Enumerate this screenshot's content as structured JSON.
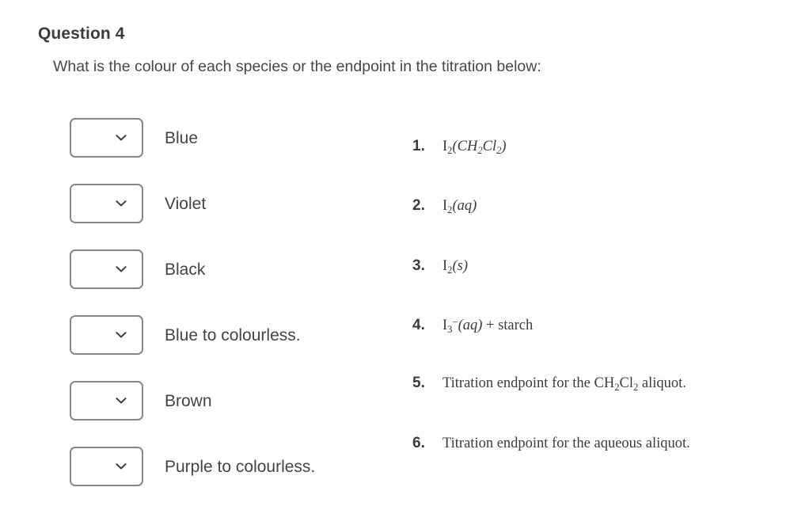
{
  "heading": {
    "question_label": "Question 4",
    "prompt": "What is the colour of each species or the endpoint in the titration below:"
  },
  "match_left": {
    "dropdown_icon": "chevron-down-icon",
    "rows": [
      {
        "selected_value": "",
        "label": "Blue"
      },
      {
        "selected_value": "",
        "label": "Violet"
      },
      {
        "selected_value": "",
        "label": "Black"
      },
      {
        "selected_value": "",
        "label": "Blue to colourless."
      },
      {
        "selected_value": "",
        "label": "Brown"
      },
      {
        "selected_value": "",
        "label": "Purple to colourless."
      }
    ]
  },
  "match_right": {
    "rows": [
      {
        "number": "1.",
        "text_plain": "I2(CH2Cl2)",
        "parts": [
          {
            "t": "I",
            "style": "normal"
          },
          {
            "t": "2",
            "style": "sub"
          },
          {
            "t": "(CH",
            "style": "italic"
          },
          {
            "t": "2",
            "style": "sub-italic"
          },
          {
            "t": "Cl",
            "style": "italic"
          },
          {
            "t": "2",
            "style": "sub-italic"
          },
          {
            "t": ")",
            "style": "italic"
          }
        ]
      },
      {
        "number": "2.",
        "text_plain": "I2(aq)",
        "parts": [
          {
            "t": "I",
            "style": "normal"
          },
          {
            "t": "2",
            "style": "sub"
          },
          {
            "t": "(aq)",
            "style": "italic"
          }
        ]
      },
      {
        "number": "3.",
        "text_plain": "I2(s)",
        "parts": [
          {
            "t": "I",
            "style": "normal"
          },
          {
            "t": "2",
            "style": "sub"
          },
          {
            "t": "(s)",
            "style": "italic"
          }
        ]
      },
      {
        "number": "4.",
        "text_plain": "I3- (aq) + starch",
        "parts": [
          {
            "t": "I",
            "style": "normal"
          },
          {
            "t": "3",
            "style": "sub"
          },
          {
            "t": "−",
            "style": "sup"
          },
          {
            "t": "(aq)",
            "style": "italic"
          },
          {
            "t": " + starch",
            "style": "normal"
          }
        ]
      },
      {
        "number": "5.",
        "text_plain": "Titration endpoint for the CH2Cl2 aliquot.",
        "parts": [
          {
            "t": "Titration endpoint for the CH",
            "style": "normal"
          },
          {
            "t": "2",
            "style": "sub"
          },
          {
            "t": "Cl",
            "style": "normal"
          },
          {
            "t": "2",
            "style": "sub"
          },
          {
            "t": " aliquot.",
            "style": "normal"
          }
        ]
      },
      {
        "number": "6.",
        "text_plain": "Titration endpoint for the aqueous aliquot.",
        "parts": [
          {
            "t": "Titration endpoint for the aqueous aliquot.",
            "style": "normal"
          }
        ]
      }
    ]
  },
  "layout": {
    "left_row_tops": [
      149,
      232,
      315,
      398,
      481,
      564
    ],
    "right_row_tops": [
      174,
      249,
      325,
      400,
      473,
      549
    ]
  },
  "colors": {
    "page_background": "#ffffff",
    "heading_text": "#3b3b3b",
    "body_text": "#444444",
    "select_border": "#80888f",
    "chevron": "#3a3a3a"
  }
}
